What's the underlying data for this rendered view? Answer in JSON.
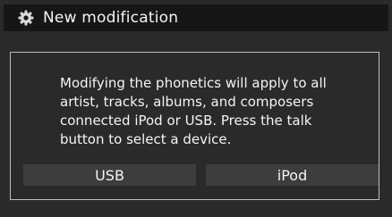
{
  "header": {
    "icon": "gear-icon",
    "title": "New modification"
  },
  "dialog": {
    "message": "Modifying the phonetics will apply to all\nartist, tracks, albums, and composers\nconnected iPod or USB. Press the talk\nbutton to select a device."
  },
  "buttons": {
    "usb_label": "USB",
    "ipod_label": "iPod"
  },
  "colors": {
    "background": "#2a2a2a",
    "title_bar": "#161616",
    "button": "#3d3d3d",
    "border": "#bdbdbd",
    "text": "#f4f4f4"
  }
}
